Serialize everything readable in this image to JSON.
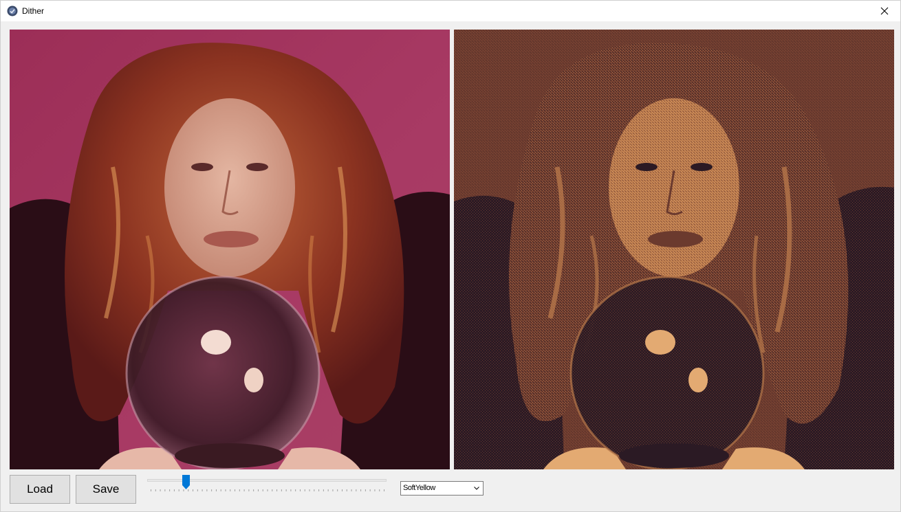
{
  "window": {
    "title": "Dither",
    "icon": "app-icon",
    "close_icon": "close-icon"
  },
  "images": {
    "original": {
      "icon": "photo-original"
    },
    "dithered": {
      "icon": "photo-dithered"
    }
  },
  "toolbar": {
    "load_label": "Load",
    "save_label": "Save"
  },
  "slider": {
    "value_fraction": 0.15,
    "tick_count": 50
  },
  "palette_select": {
    "selected": "SoftYellow"
  },
  "colors": {
    "accent": "#0078d7",
    "original_bg": "#a3375f",
    "dither_dark": "#2b1a24",
    "dither_mid": "#6b3a2e",
    "dither_light": "#b7774a",
    "dither_highlight": "#e3aa72"
  }
}
